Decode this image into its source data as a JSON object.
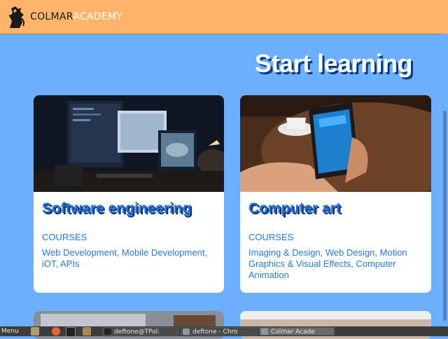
{
  "header": {
    "brand_part1": "COLMAR",
    "brand_part2": "ACADEMY",
    "logo_icon": "lion-crest-icon"
  },
  "main": {
    "title": "Start learning",
    "cards": [
      {
        "title": "Software engineering",
        "label": "COURSES",
        "courses": "Web Development, Mobile Development, iOT, APIs",
        "image": "desk-with-monitors-image"
      },
      {
        "title": "Computer art",
        "label": "COURSES",
        "courses": "Imaging & Design, Web Design, Motion Graphics & Visual Effects, Computer Animation",
        "image": "hand-holding-phone-image"
      }
    ]
  },
  "taskbar": {
    "menu_label": "Menu",
    "tasks": [
      "deftone@TPol:",
      "deftone - Chro",
      "Colmar Acade"
    ]
  },
  "colors": {
    "page_bg": "#6ab0ff",
    "header_bg": "#ffb46a",
    "accent": "#1d6fd6"
  }
}
